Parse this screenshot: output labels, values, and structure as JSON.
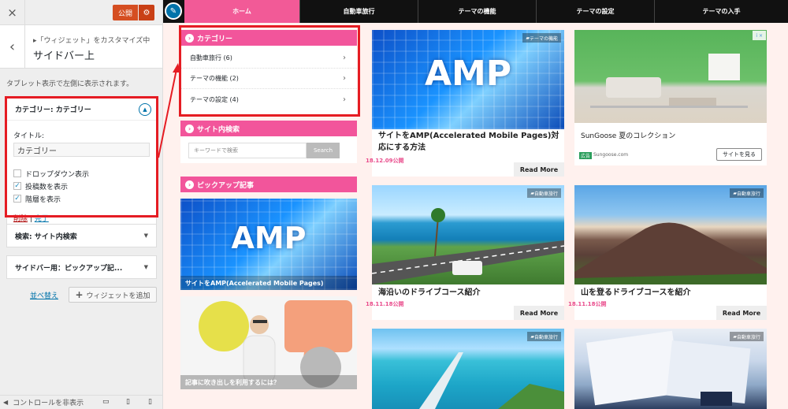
{
  "customizer": {
    "close_icon": "×",
    "publish_label": "公開",
    "gear_icon": "⚙",
    "back_icon": "‹",
    "breadcrumb": "▸「ウィジェット」をカスタマイズ中",
    "section_title": "サイドバー上",
    "description": "タブレット表示で左側に表示されます。",
    "widget_open": {
      "title": "カテゴリー: カテゴリー",
      "toggle_icon": "▲",
      "title_label": "タイトル:",
      "title_value": "カテゴリー",
      "checks": [
        {
          "label": "ドロップダウン表示",
          "checked": false
        },
        {
          "label": "投稿数を表示",
          "checked": true
        },
        {
          "label": "階層を表示",
          "checked": true
        }
      ],
      "delete_label": "削除",
      "separator": " | ",
      "done_label": "完了"
    },
    "widgets_closed": [
      {
        "title": "検索: サイト内検索"
      },
      {
        "title": "サイドバー用：ピックアップ記..."
      }
    ],
    "closed_arrow": "▼",
    "reorder_label": "並べ替え",
    "add_widget_icon": "+",
    "add_widget_label": "ウィジェットを追加",
    "footer_icon": "◀",
    "footer_label": "コントロールを非表示",
    "device_icons": [
      "▭",
      "▯",
      "▯"
    ]
  },
  "preview": {
    "edit_icon": "✎",
    "nav": [
      "ホーム",
      "自動車旅行",
      "テーマの機能",
      "テーマの設定",
      "テーマの入手"
    ],
    "category_widget": {
      "title": "カテゴリー",
      "items": [
        "自動車旅行 (6)",
        "テーマの機能 (2)",
        "テーマの設定 (4)"
      ],
      "chevron": "›"
    },
    "search_widget": {
      "title": "サイト内検索",
      "placeholder": "キーワードで検索",
      "button": "Search"
    },
    "pickup_widget": {
      "title": "ピックアップ記事",
      "items": [
        {
          "image_text": "AMP",
          "caption": "サイトをAMP(Accelerated Mobile Pages)"
        },
        {
          "caption": "記事に吹き出しを利用するには？"
        }
      ]
    },
    "header_dot": "›",
    "cards": [
      {
        "badge": "テーマの機能",
        "image_text": "AMP",
        "title": "サイトをAMP(Accelerated Mobile Pages)対応にする方法",
        "date": "18.12.09公開",
        "read_more": "Read More"
      },
      {
        "ad_title": "SunGoose 夏のコレクション",
        "ad_tag": "広告",
        "ad_domain": "Sungoose.com",
        "ad_button": "サイトを見る",
        "ad_marks": "i ×"
      },
      {
        "badge": "自動車旅行",
        "title": "海沿いのドライブコース紹介",
        "date": "18.11.18公開",
        "read_more": "Read More"
      },
      {
        "badge": "自動車旅行",
        "title": "山を登るドライブコースを紹介",
        "date": "18.11.18公開",
        "read_more": "Read More"
      },
      {
        "badge": "自動車旅行"
      },
      {
        "badge": "自動車旅行"
      }
    ],
    "badge_icon": "▰"
  },
  "colors": {
    "accent_pink": "#f25a97",
    "publish": "#d54e21",
    "highlight_red": "#e51c23",
    "link_blue": "#0073aa"
  }
}
